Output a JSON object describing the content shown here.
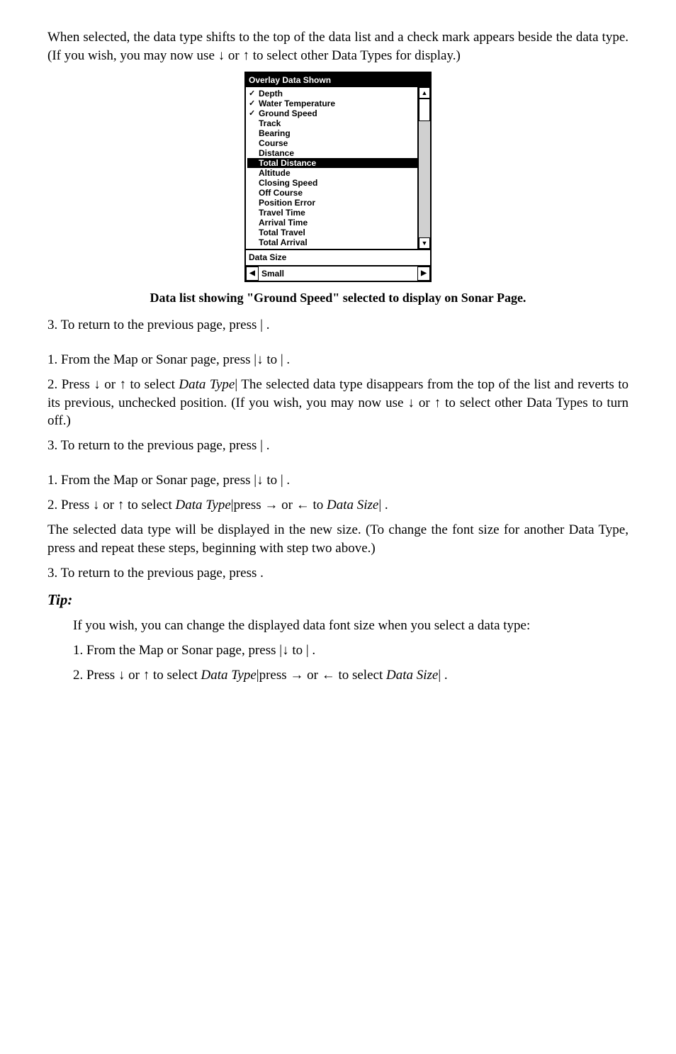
{
  "intro": "When selected, the data type shifts to the top of the data list and a check mark appears beside the data type. (If you wish, you may now use ↓ or ↑ to select other Data Types for display.)",
  "screenshot": {
    "title": "Overlay Data Shown",
    "items": [
      {
        "label": "Depth",
        "checked": true,
        "selected": false
      },
      {
        "label": "Water Temperature",
        "checked": true,
        "selected": false
      },
      {
        "label": "Ground Speed",
        "checked": true,
        "selected": false
      },
      {
        "label": "Track",
        "checked": false,
        "selected": false
      },
      {
        "label": "Bearing",
        "checked": false,
        "selected": false
      },
      {
        "label": "Course",
        "checked": false,
        "selected": false
      },
      {
        "label": "Distance",
        "checked": false,
        "selected": false
      },
      {
        "label": "Total Distance",
        "checked": false,
        "selected": true
      },
      {
        "label": "Altitude",
        "checked": false,
        "selected": false
      },
      {
        "label": "Closing Speed",
        "checked": false,
        "selected": false
      },
      {
        "label": "Off Course",
        "checked": false,
        "selected": false
      },
      {
        "label": "Position Error",
        "checked": false,
        "selected": false
      },
      {
        "label": "Travel Time",
        "checked": false,
        "selected": false
      },
      {
        "label": "Arrival Time",
        "checked": false,
        "selected": false
      },
      {
        "label": "Total Travel",
        "checked": false,
        "selected": false
      },
      {
        "label": "Total Arrival",
        "checked": false,
        "selected": false
      }
    ],
    "section_label": "Data Size",
    "size_value": "Small"
  },
  "caption": "Data list showing \"Ground Speed\" selected to display on Sonar Page.",
  "block1": {
    "step3": "3. To return to the previous page, press        |     ."
  },
  "block2": {
    "step1": "1. From the Map or Sonar page, press        |↓ to                     |     .",
    "step2a": "2. Press ↓ or ↑ to select ",
    "step2_dt": "Data Type",
    "step2b": "|        The selected data type disappears from the top of the list and reverts to its previous, unchecked position. (If you wish, you may now use ↓ or ↑ to select other Data Types to turn off.)",
    "step3": "3. To return to the previous page, press        |     ."
  },
  "block3": {
    "step1": "1. From the Map or Sonar page, press        |↓ to                     |     .",
    "step2a": "2. Press ↓ or ↑ to select ",
    "step2_dt": "Data Type",
    "step2b": "|press → or ← to ",
    "step2_ds": "Data Size",
    "step2c": "|        .",
    "para": "The selected data type will be displayed in the new size. (To change the font size for another Data Type, press        and repeat these steps, beginning with step two above.)",
    "step3": "3. To return to the previous page, press     ."
  },
  "tip": {
    "label": "Tip:",
    "intro": "If you wish, you can change the displayed data font size when you select a data type:",
    "step1": "1.  From  the  Map  or  Sonar  page,  press          |↓  to          |     .",
    "step2a": "2. Press ↓ or ↑ to select ",
    "step2_dt": "Data Type",
    "step2b": "|press → or ← to select ",
    "step2_ds": "Data Size",
    "step2c": "|     ."
  },
  "glyphs": {
    "check": "✓",
    "up": "▲",
    "down": "▼",
    "left": "◀",
    "right": "▶"
  }
}
